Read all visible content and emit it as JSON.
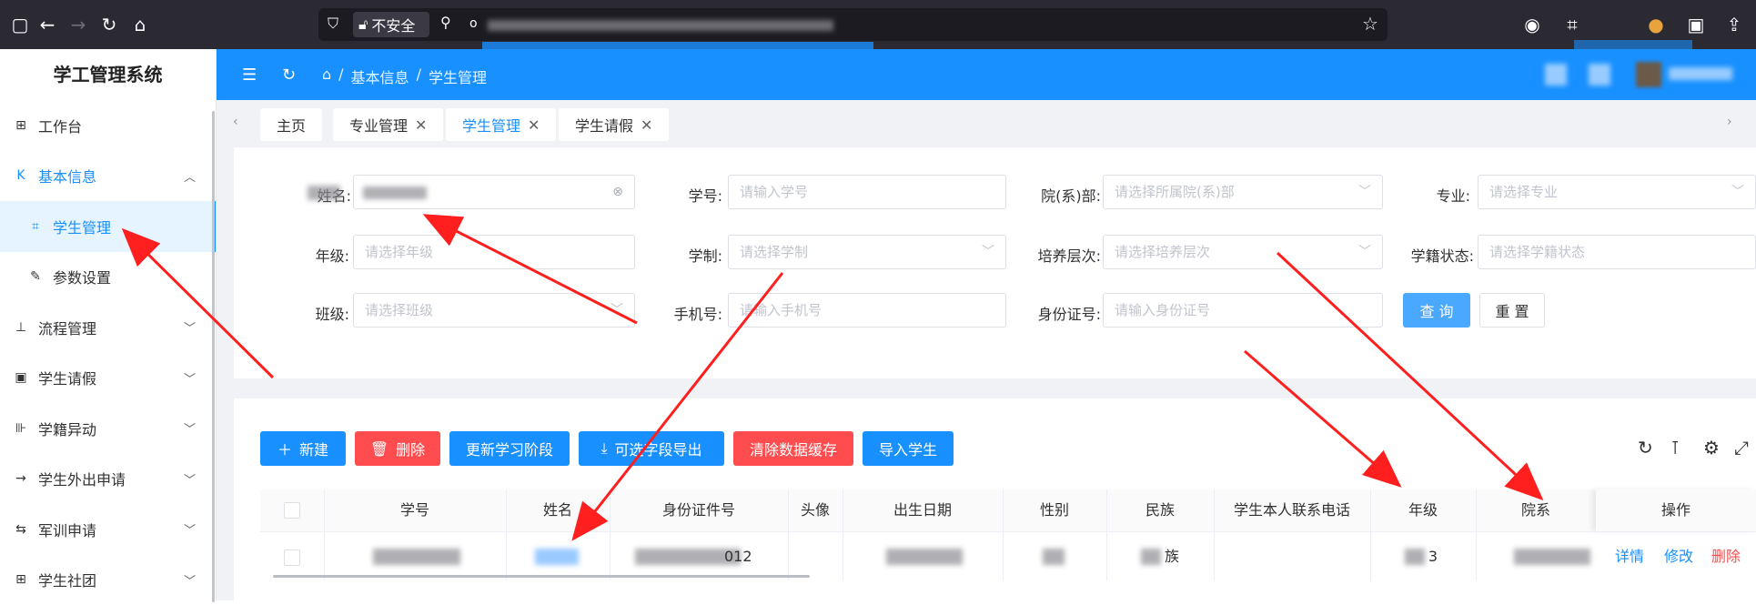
{
  "browser": {
    "security_text": "不安全"
  },
  "sidebar": {
    "title": "学工管理系统",
    "items": [
      {
        "label": "工作台",
        "icon": "dashboard-icon"
      },
      {
        "label": "基本信息",
        "icon": "collapse-k-icon"
      },
      {
        "label": "学生管理",
        "icon": "scan-icon"
      },
      {
        "label": "参数设置",
        "icon": "edit-icon"
      },
      {
        "label": "流程管理",
        "icon": "download-icon"
      },
      {
        "label": "学生请假",
        "icon": "tablet-icon"
      },
      {
        "label": "学籍异动",
        "icon": "column-icon"
      },
      {
        "label": "学生外出申请",
        "icon": "arrow-right-icon"
      },
      {
        "label": "军训申请",
        "icon": "swap-icon"
      },
      {
        "label": "学生社团",
        "icon": "grid-icon"
      }
    ]
  },
  "topbar": {
    "breadcrumb": [
      "基本信息",
      "学生管理"
    ]
  },
  "tags": [
    {
      "label": "主页",
      "closable": false,
      "active": false
    },
    {
      "label": "专业管理",
      "closable": true,
      "active": false
    },
    {
      "label": "学生管理",
      "closable": true,
      "active": true
    },
    {
      "label": "学生请假",
      "closable": true,
      "active": false
    }
  ],
  "filters": {
    "name_label": "姓名:",
    "student_no_label": "学号:",
    "student_no_placeholder": "请输入学号",
    "dept_label": "院(系)部:",
    "dept_placeholder": "请选择所属院(系)部",
    "major_label": "专业:",
    "major_placeholder": "请选择专业",
    "grade_label": "年级:",
    "grade_placeholder": "请选择年级",
    "system_label": "学制:",
    "system_placeholder": "请选择学制",
    "level_label": "培养层次:",
    "level_placeholder": "请选择培养层次",
    "status_label": "学籍状态:",
    "status_placeholder": "请选择学籍状态",
    "class_label": "班级:",
    "class_placeholder": "请选择班级",
    "phone_label": "手机号:",
    "phone_placeholder": "请输入手机号",
    "id_label": "身份证号:",
    "id_placeholder": "请输入身份证号",
    "query_button": "查 询",
    "reset_button": "重 置"
  },
  "toolbar": {
    "new": "新建",
    "delete": "删除",
    "update_stage": "更新学习阶段",
    "export": "可选字段导出",
    "clear_cache": "清除数据缓存",
    "import": "导入学生"
  },
  "table": {
    "columns": [
      "学号",
      "姓名",
      "身份证件号",
      "头像",
      "出生日期",
      "性别",
      "民族",
      "学生本人联系电话",
      "年级",
      "院系",
      "操作"
    ],
    "row": {
      "id_suffix": "012",
      "ethnicity_suffix": "族",
      "grade_suffix": "3",
      "actions": [
        "详情",
        "修改",
        "删除"
      ]
    }
  },
  "colors": {
    "primary": "#1890ff",
    "danger": "#ff4d4f",
    "annotation": "#ff1f1f"
  }
}
